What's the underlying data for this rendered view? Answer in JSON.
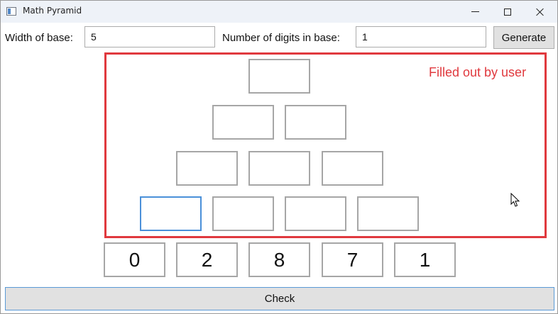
{
  "window": {
    "title": "Math Pyramid"
  },
  "window_controls": {
    "minimize": "minimize",
    "maximize": "maximize",
    "close": "close"
  },
  "toolbar": {
    "width_label": "Width of base:",
    "width_value": "5",
    "digits_label": "Number of digits in base:",
    "digits_value": "1",
    "generate_label": "Generate"
  },
  "annotation": {
    "text": "Filled out by user",
    "color": "#e0393e"
  },
  "pyramid": {
    "rows": [
      {
        "cells": [
          "",
          ""
        ]
      },
      {
        "cells": [
          "",
          "",
          ""
        ]
      }
    ]
  },
  "base": {
    "digits": [
      "0",
      "2",
      "8",
      "7",
      "1"
    ]
  },
  "check": {
    "label": "Check"
  },
  "icons": [
    "app-icon",
    "minimize-icon",
    "maximize-icon",
    "close-icon",
    "mouse-cursor-icon"
  ]
}
